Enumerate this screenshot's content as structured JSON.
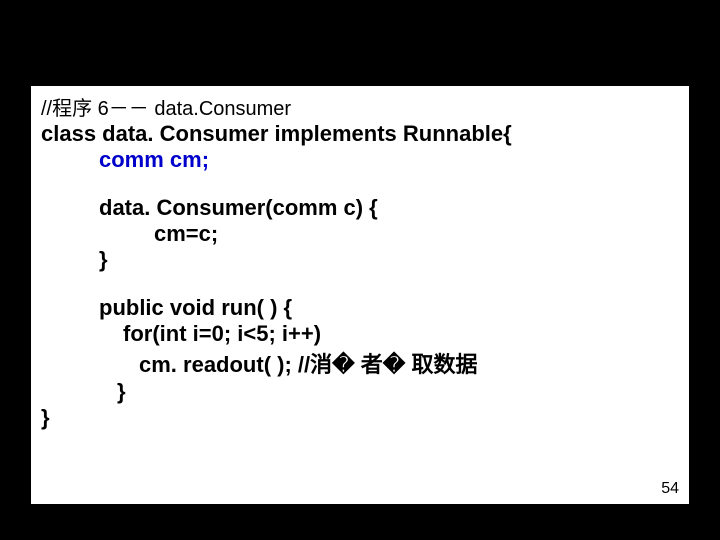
{
  "slide": {
    "comment": "//程序 6－－ data.Consumer",
    "class_line": "class data. Consumer implements Runnable{",
    "field_type": "comm ",
    "field_name": "cm;",
    "ctor_sig": "data. Consumer(comm c) {",
    "ctor_body": "cm=c;",
    "ctor_close": "}",
    "run_sig": "public void run( ) {",
    "run_for": "for(int i=0; i<5; i++)",
    "run_call": "cm. readout( ); //消� 者� 取数据",
    "run_close": "}",
    "class_close": "}",
    "page_number": "54"
  }
}
